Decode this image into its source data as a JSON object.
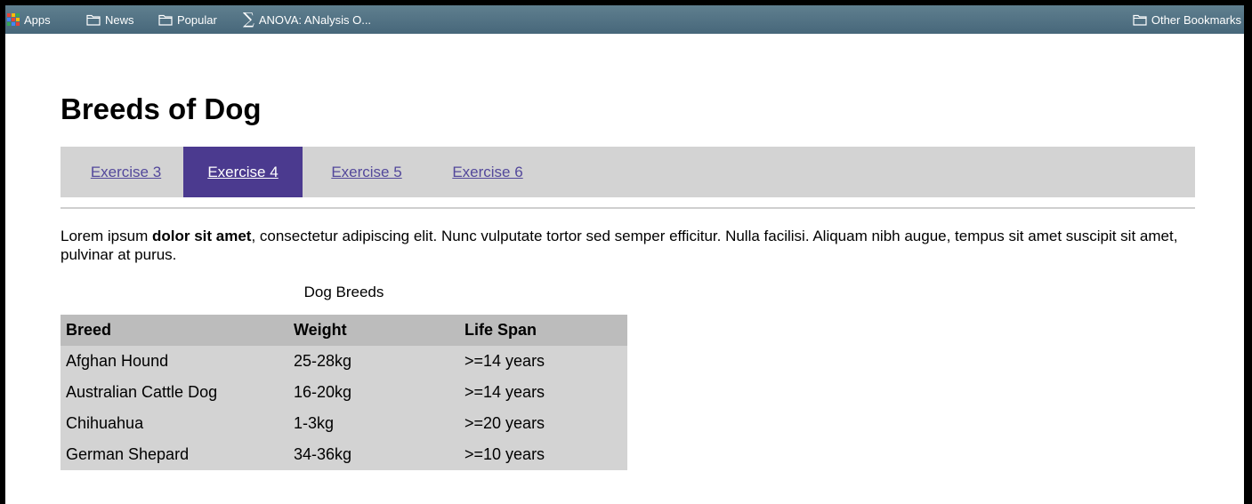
{
  "bookmarks_bar": {
    "apps": "Apps",
    "news": "News",
    "popular": "Popular",
    "anova": "ANOVA: ANalysis O...",
    "other": "Other Bookmarks"
  },
  "page": {
    "title": "Breeds of Dog",
    "tabs": [
      {
        "label": "Exercise 3",
        "active": false
      },
      {
        "label": "Exercise 4",
        "active": true
      },
      {
        "label": "Exercise 5",
        "active": false
      },
      {
        "label": "Exercise 6",
        "active": false
      }
    ],
    "intro": {
      "before": "Lorem ipsum ",
      "bold": "dolor sit amet",
      "after": ", consectetur adipiscing elit. Nunc vulputate tortor sed semper efficitur. Nulla facilisi. Aliquam nibh augue, tempus sit amet suscipit sit amet, pulvinar at purus."
    },
    "table": {
      "caption": "Dog Breeds",
      "headers": [
        "Breed",
        "Weight",
        "Life Span"
      ],
      "rows": [
        [
          "Afghan Hound",
          "25-28kg",
          ">=14 years"
        ],
        [
          "Australian Cattle Dog",
          "16-20kg",
          ">=14 years"
        ],
        [
          "Chihuahua",
          "1-3kg",
          ">=20 years"
        ],
        [
          "German Shepard",
          "34-36kg",
          ">=10 years"
        ]
      ]
    }
  },
  "colors": {
    "tab_active_bg": "#4b3a8f",
    "link": "#53489b",
    "nav_bg": "#d3d3d3",
    "table_header_bg": "#bcbcbc"
  },
  "icons": {
    "apps": "apps-grid-icon",
    "folder": "folder-icon",
    "sigma": "sigma-icon"
  }
}
